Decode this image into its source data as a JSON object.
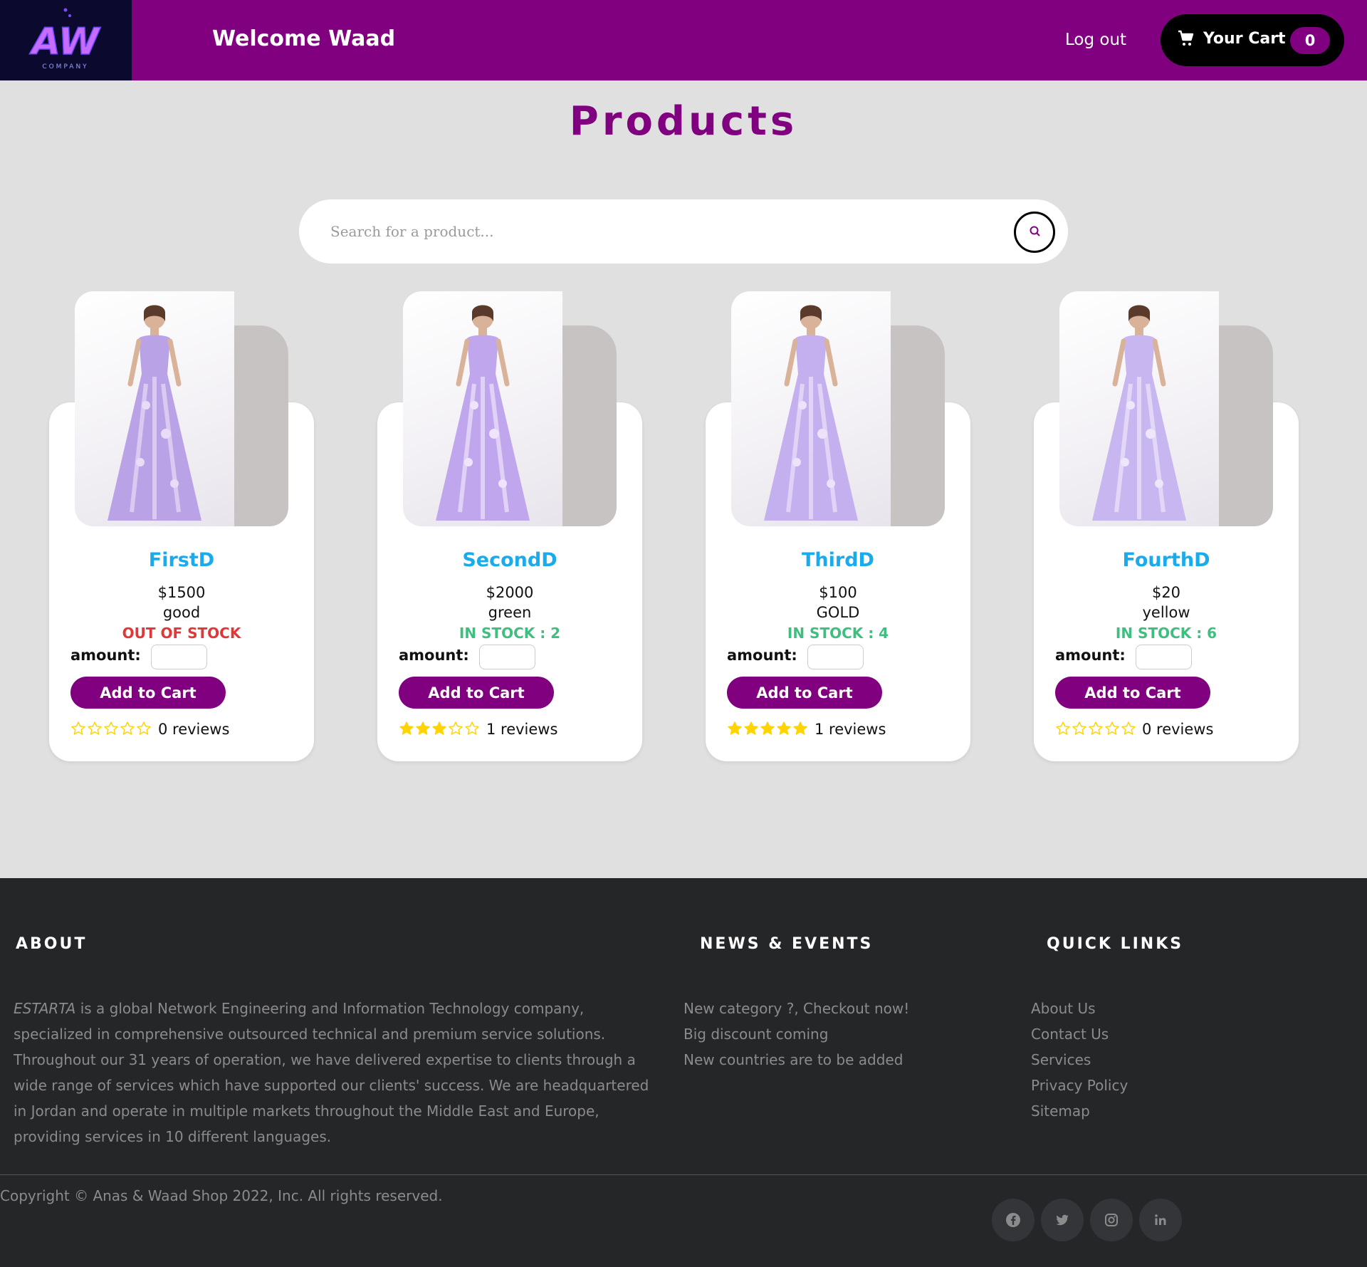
{
  "header": {
    "welcome": "Welcome Waad",
    "logout": "Log out",
    "cart_label": "Your Cart",
    "cart_count": "0",
    "logo_text": "AW",
    "logo_sub": "COMPANY"
  },
  "main": {
    "title": "Products",
    "search_placeholder": "Search for a product..."
  },
  "products": [
    {
      "name": "FirstD",
      "price": "$1500",
      "description": "good",
      "stock": "OUT OF STOCK",
      "amount_label": "amount:",
      "button": "Add to Cart",
      "rating": 0,
      "reviews": "0 reviews"
    },
    {
      "name": "SecondD",
      "price": "$2000",
      "description": "green",
      "stock": "IN STOCK : 2",
      "amount_label": "amount:",
      "button": "Add to Cart",
      "rating": 3,
      "reviews": "1 reviews"
    },
    {
      "name": "ThirdD",
      "price": "$100",
      "description": "GOLD",
      "stock": "IN STOCK : 4",
      "amount_label": "amount:",
      "button": "Add to Cart",
      "rating": 5,
      "reviews": "1 reviews"
    },
    {
      "name": "FourthD",
      "price": "$20",
      "description": "yellow",
      "stock": "IN STOCK : 6",
      "amount_label": "amount:",
      "button": "Add to Cart",
      "rating": 0,
      "reviews": "0 reviews"
    }
  ],
  "footer": {
    "about_heading": "ABOUT",
    "about_brand": "ESTARTA",
    "about_text": " is a global Network Engineering and Information Technology company, specialized in comprehensive outsourced technical and premium service solutions. Throughout our 31 years of operation, we have delivered expertise to clients through a wide range of services which have supported our clients' success. We are headquartered in Jordan and operate in multiple markets throughout the Middle East and Europe, providing services in 10 different languages.",
    "news_heading": "NEWS & EVENTS",
    "news": [
      "New category ?, Checkout now!",
      "Big discount coming",
      "New countries are to be added"
    ],
    "links_heading": "QUICK LINKS",
    "links": [
      "About Us",
      "Contact Us",
      "Services",
      "Privacy Policy",
      "Sitemap"
    ],
    "copyright": "Copyright © Anas & Waad Shop 2022, Inc. All rights reserved.",
    "social_icons": [
      "facebook-icon",
      "twitter-icon",
      "instagram-icon",
      "linkedin-icon"
    ]
  },
  "colors": {
    "brand": "#800080",
    "product_name": "#1aabec",
    "out_of_stock": "#e03838",
    "in_stock": "#3fbf7f",
    "star": "#ffd400",
    "footer_bg": "#252628"
  }
}
